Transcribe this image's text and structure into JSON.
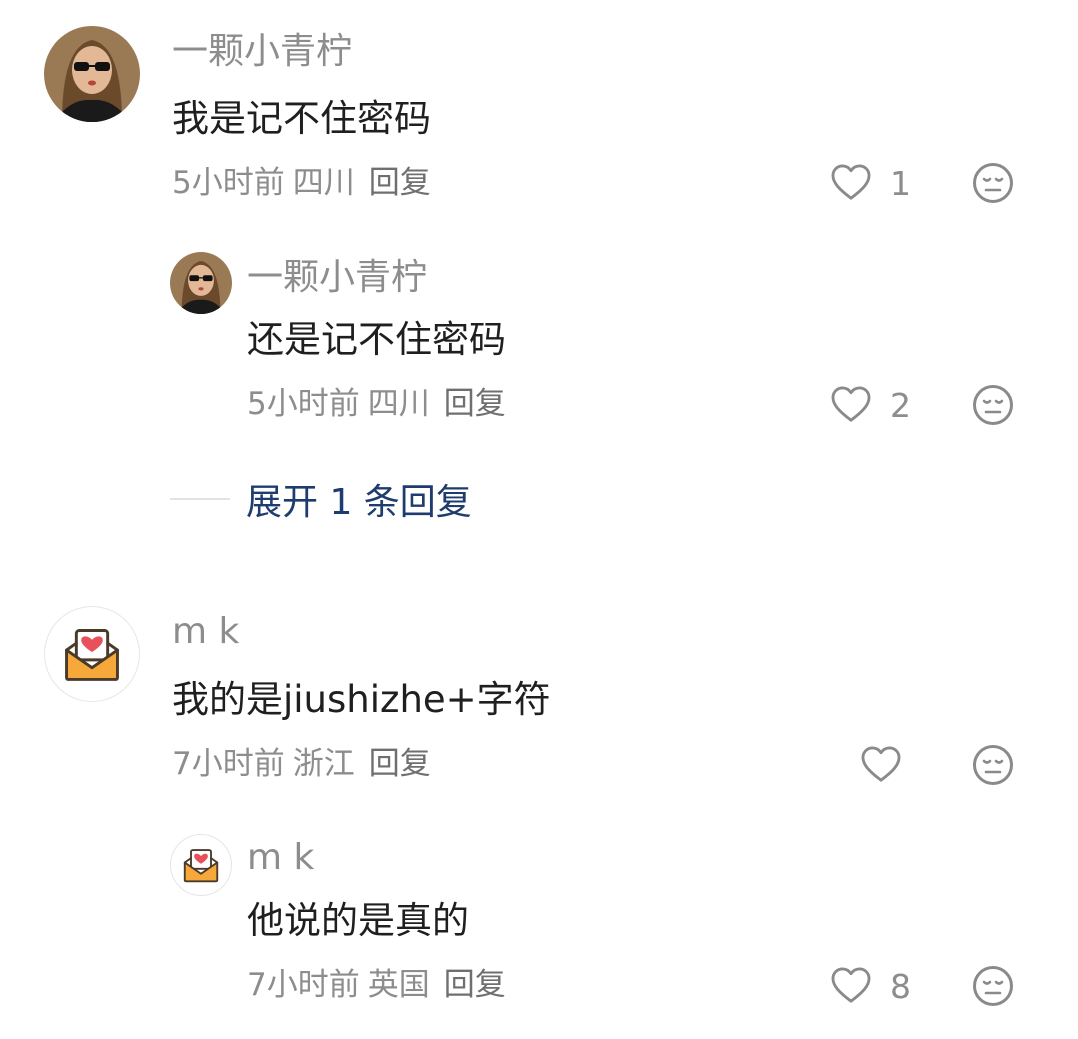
{
  "comments": [
    {
      "user": "一颗小青柠",
      "text": "我是记不住密码",
      "time": "5小时前",
      "location": "四川",
      "reply_label": "回复",
      "likes": "1",
      "avatar": "photo-avatar"
    },
    {
      "user": "一颗小青柠",
      "text": "还是记不住密码",
      "time": "5小时前",
      "location": "四川",
      "reply_label": "回复",
      "likes": "2",
      "avatar": "photo-avatar"
    },
    {
      "user": "m k",
      "text": "我的是jiushizhe+字符",
      "time": "7小时前",
      "location": "浙江",
      "reply_label": "回复",
      "likes": "",
      "avatar": "envelope-heart-icon"
    },
    {
      "user": "m k",
      "text": "他说的是真的",
      "time": "7小时前",
      "location": "英国",
      "reply_label": "回复",
      "likes": "8",
      "avatar": "envelope-heart-icon"
    }
  ],
  "expand": {
    "label": "展开 1 条回复"
  },
  "colors": {
    "link": "#1e3c6e",
    "meta": "#8d8d8d",
    "text": "#1f1f1f"
  }
}
